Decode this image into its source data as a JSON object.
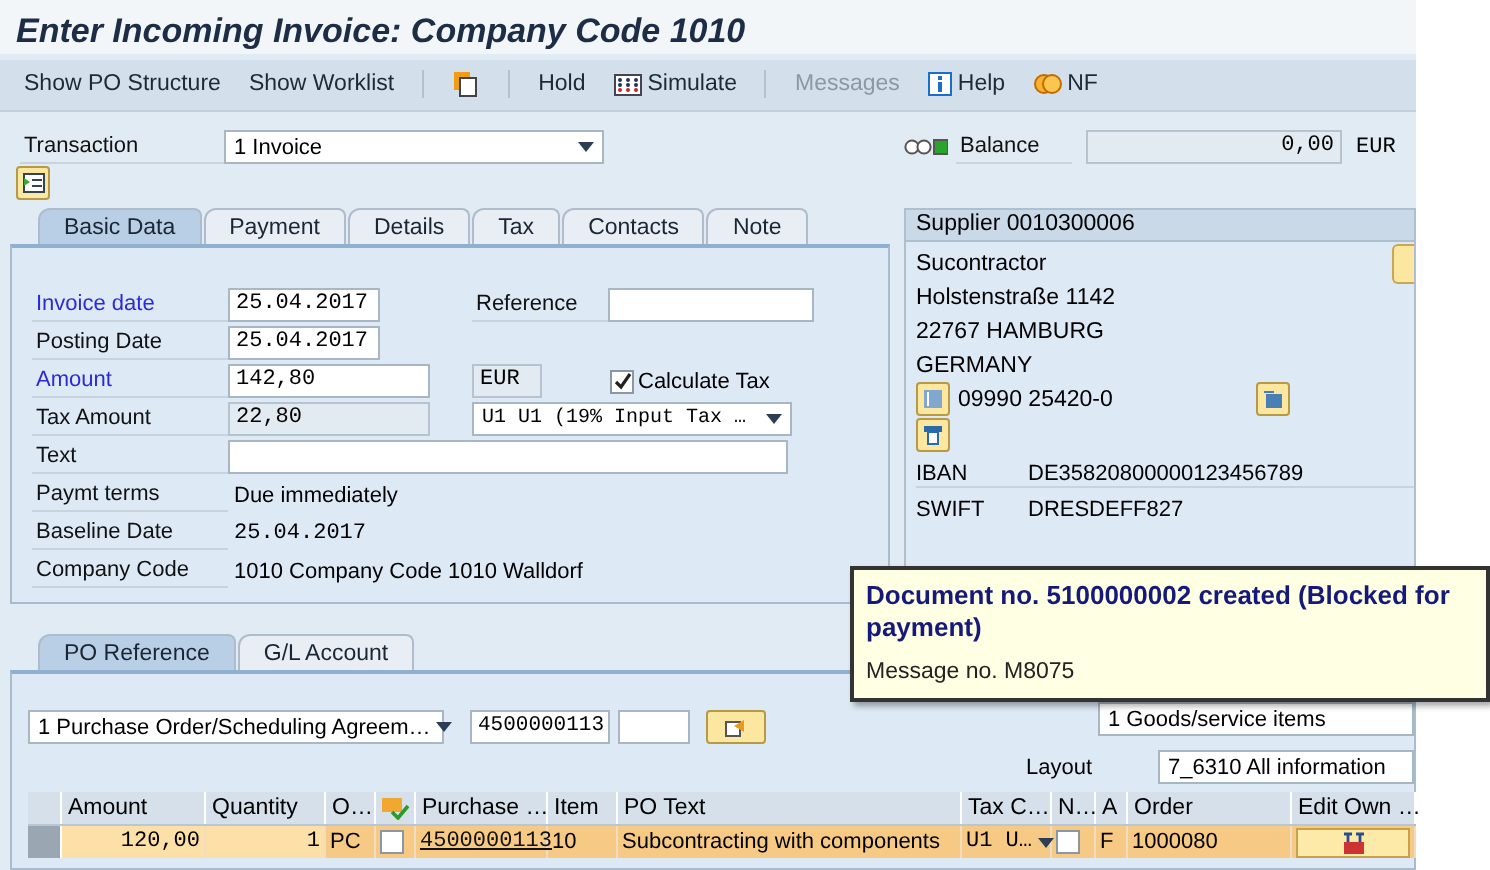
{
  "title": "Enter Incoming Invoice: Company Code 1010",
  "toolbar": [
    {
      "label": "Show PO Structure",
      "disabled": false
    },
    {
      "label": "Show Worklist",
      "disabled": false
    },
    {
      "label": "Hold",
      "disabled": false
    },
    {
      "label": "Simulate",
      "disabled": false
    },
    {
      "label": "Messages",
      "disabled": true
    },
    {
      "label": "Help",
      "disabled": false
    },
    {
      "label": "NF",
      "disabled": false
    }
  ],
  "transaction": {
    "label": "Transaction",
    "value": "1 Invoice"
  },
  "balance": {
    "label": "Balance",
    "value": "0,00",
    "currency": "EUR",
    "balanced": true
  },
  "tabs": [
    {
      "label": "Basic Data",
      "selected": true
    },
    {
      "label": "Payment",
      "selected": false
    },
    {
      "label": "Details",
      "selected": false
    },
    {
      "label": "Tax",
      "selected": false
    },
    {
      "label": "Contacts",
      "selected": false
    },
    {
      "label": "Note",
      "selected": false
    }
  ],
  "basic_data": {
    "invoice_date": {
      "label": "Invoice date",
      "value": "25.04.2017",
      "required": true
    },
    "reference": {
      "label": "Reference"
    },
    "posting_date": {
      "label": "Posting Date",
      "value": "25.04.2017",
      "required": false
    },
    "amount": {
      "label": "Amount",
      "value": "142,80",
      "required": true
    },
    "currency": "EUR",
    "calculate_tax": {
      "label": "Calculate Tax",
      "checked": true
    },
    "tax_amount": {
      "label": "Tax Amount",
      "value": "22,80",
      "required": false
    },
    "tax_code": "U1 U1 (19% Input Tax …",
    "text": {
      "label": "Text",
      "required": false
    },
    "payment_terms": {
      "label": "Paymt terms",
      "value": "Due immediately"
    },
    "baseline_date": {
      "label": "Baseline Date",
      "value": "25.04.2017"
    },
    "company_code": {
      "label": "Company Code",
      "value": "1010 Company Code 1010 Walldorf"
    }
  },
  "supplier": {
    "title": "Supplier 0010300006",
    "address": [
      "Sucontractor",
      "Holstenstraße 1142",
      "22767 HAMBURG",
      "GERMANY"
    ],
    "phone": "09990 25420-0",
    "iban": {
      "label": "IBAN",
      "value": "DE35820800000123456789"
    },
    "swift": {
      "label": "SWIFT",
      "value": "DRESDEFF827"
    }
  },
  "message": {
    "text": "Document no. 5100000002 created (Blocked for payment)",
    "number": "Message no. M8075"
  },
  "lower_tabs": [
    {
      "label": "PO Reference",
      "selected": true
    },
    {
      "label": "G/L Account",
      "selected": false
    }
  ],
  "po_reference": {
    "document_type": "1 Purchase Order/Scheduling Agreem…",
    "po_number": "4500000113",
    "items_view": "1 Goods/service items",
    "layout": {
      "label": "Layout",
      "value": "7_6310 All information"
    }
  },
  "table": {
    "columns": [
      {
        "kind": "text",
        "label": "Amount"
      },
      {
        "kind": "text",
        "label": "Quantity"
      },
      {
        "kind": "text",
        "label": "O…"
      },
      {
        "kind": "icon"
      },
      {
        "kind": "text",
        "label": "Purchase …"
      },
      {
        "kind": "text",
        "label": "Item"
      },
      {
        "kind": "text",
        "label": "PO Text"
      },
      {
        "kind": "text",
        "label": "Tax C…"
      },
      {
        "kind": "text",
        "label": "N…"
      },
      {
        "kind": "text",
        "label": "A"
      },
      {
        "kind": "text",
        "label": "Order"
      },
      {
        "kind": "text",
        "label": "Edit Own …"
      }
    ],
    "rows": [
      {
        "selected": true,
        "cells": [
          {
            "kind": "number",
            "value": "120,00"
          },
          {
            "kind": "number",
            "value": "1"
          },
          {
            "kind": "text",
            "value": "PC"
          },
          {
            "kind": "checkbox",
            "checked": false
          },
          {
            "kind": "link",
            "value": "4500000113"
          },
          {
            "kind": "text",
            "value": "10"
          },
          {
            "kind": "text",
            "value": "Subcontracting with components"
          },
          {
            "kind": "dropdown",
            "value": "U1 U…"
          },
          {
            "kind": "checkbox",
            "checked": false
          },
          {
            "kind": "text",
            "value": "F"
          },
          {
            "kind": "text",
            "value": "1000080"
          },
          {
            "kind": "button"
          }
        ]
      }
    ]
  }
}
